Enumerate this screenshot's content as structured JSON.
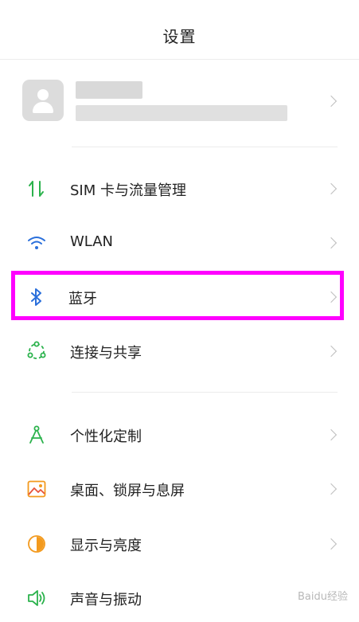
{
  "header": {
    "title": "设置"
  },
  "account": {
    "icon": "avatar-placeholder-icon"
  },
  "settings_items": [
    {
      "label": "SIM 卡与流量管理",
      "icon": "sim-data-arrows-icon"
    },
    {
      "label": "WLAN",
      "icon": "wifi-icon"
    },
    {
      "label": "蓝牙",
      "icon": "bluetooth-icon",
      "highlighted": true
    },
    {
      "label": "连接与共享",
      "icon": "connection-share-icon"
    },
    {
      "label": "个性化定制",
      "icon": "compass-customize-icon"
    },
    {
      "label": "桌面、锁屏与息屏",
      "icon": "wallpaper-icon"
    },
    {
      "label": "显示与亮度",
      "icon": "brightness-icon"
    },
    {
      "label": "声音与振动",
      "icon": "speaker-icon"
    }
  ],
  "watermark": {
    "text": "Baidu经验"
  },
  "colors": {
    "highlight_border": "#ff00ff",
    "icon_green": "#2bb24c",
    "icon_blue": "#2a6fdb",
    "icon_orange": "#f39a1e",
    "chevron": "#bdbdbd"
  }
}
